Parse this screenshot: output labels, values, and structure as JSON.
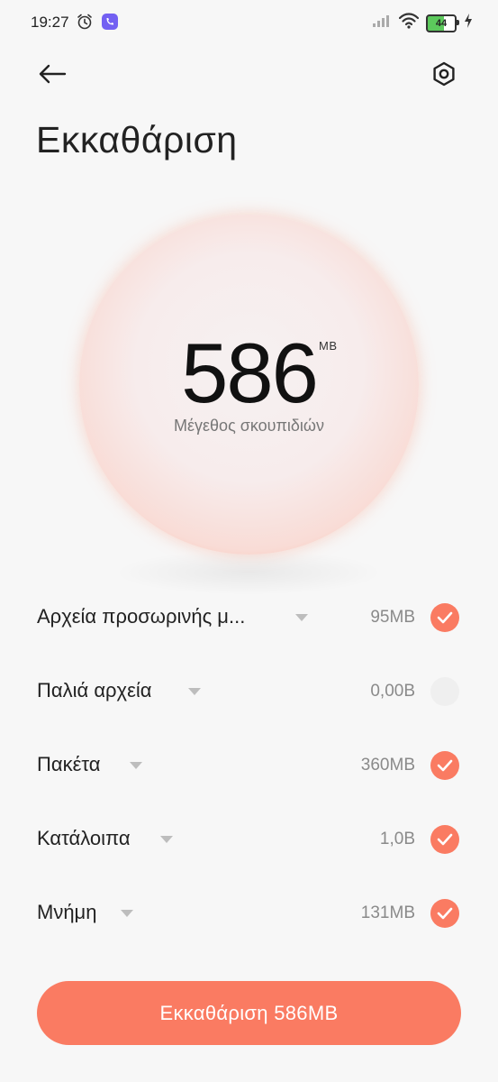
{
  "status_bar": {
    "time": "19:27",
    "battery_level": "44"
  },
  "header": {
    "title": "Εκκαθάριση"
  },
  "summary": {
    "value": "586",
    "unit": "MB",
    "label": "Μέγεθος σκουπιδιών"
  },
  "items": [
    {
      "name": "Αρχεία προσωρινής μ...",
      "size": "95MB",
      "checked": true
    },
    {
      "name": "Παλιά αρχεία",
      "size": "0,00B",
      "checked": false
    },
    {
      "name": "Πακέτα",
      "size": "360MB",
      "checked": true
    },
    {
      "name": "Κατάλοιπα",
      "size": "1,0B",
      "checked": true
    },
    {
      "name": "Μνήμη",
      "size": "131MB",
      "checked": true
    }
  ],
  "action": {
    "clean_label": "Εκκαθάριση 586MB"
  },
  "colors": {
    "accent": "#fa7b62",
    "background": "#f7f7f7"
  }
}
